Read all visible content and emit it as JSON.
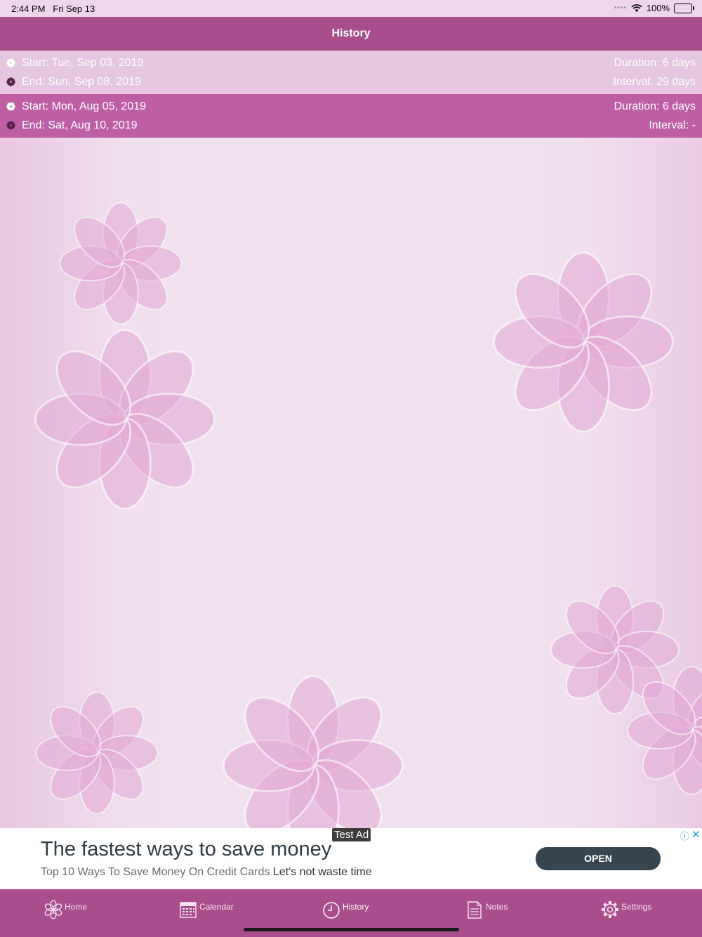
{
  "status_bar": {
    "time": "2:44 PM",
    "date": "Fri Sep 13",
    "battery": "100%"
  },
  "nav": {
    "title": "History"
  },
  "history": [
    {
      "start": "Start: Tue, Sep 03, 2019",
      "end": "End: Sun, Sep 08, 2019",
      "duration": "Duration: 6 days",
      "interval": "Interval: 29 days"
    },
    {
      "start": "Start: Mon, Aug 05, 2019",
      "end": "End: Sat, Aug 10, 2019",
      "duration": "Duration: 6 days",
      "interval": "Interval: -"
    }
  ],
  "ad": {
    "tag": "Test Ad",
    "headline": "The fastest ways to save money",
    "sub": "Top 10 Ways To Save Money On Credit Cards",
    "sub_tail": "Let's not waste time",
    "button": "OPEN",
    "close": "✕",
    "info": "ⓘ"
  },
  "tabs": {
    "home": "Home",
    "calendar": "Calendar",
    "history": "History",
    "notes": "Notes",
    "settings": "Settings"
  },
  "colors": {
    "accent": "#a84e8c",
    "row_selected": "#be5fa6",
    "row_light": "#e6c6e0",
    "background": "#f1dfee"
  },
  "icons": {
    "start": "flower-icon",
    "end": "flower-dark-icon",
    "home": "flower-icon",
    "calendar": "calendar-icon",
    "history": "clock-icon",
    "notes": "document-icon",
    "settings": "gear-icon"
  }
}
